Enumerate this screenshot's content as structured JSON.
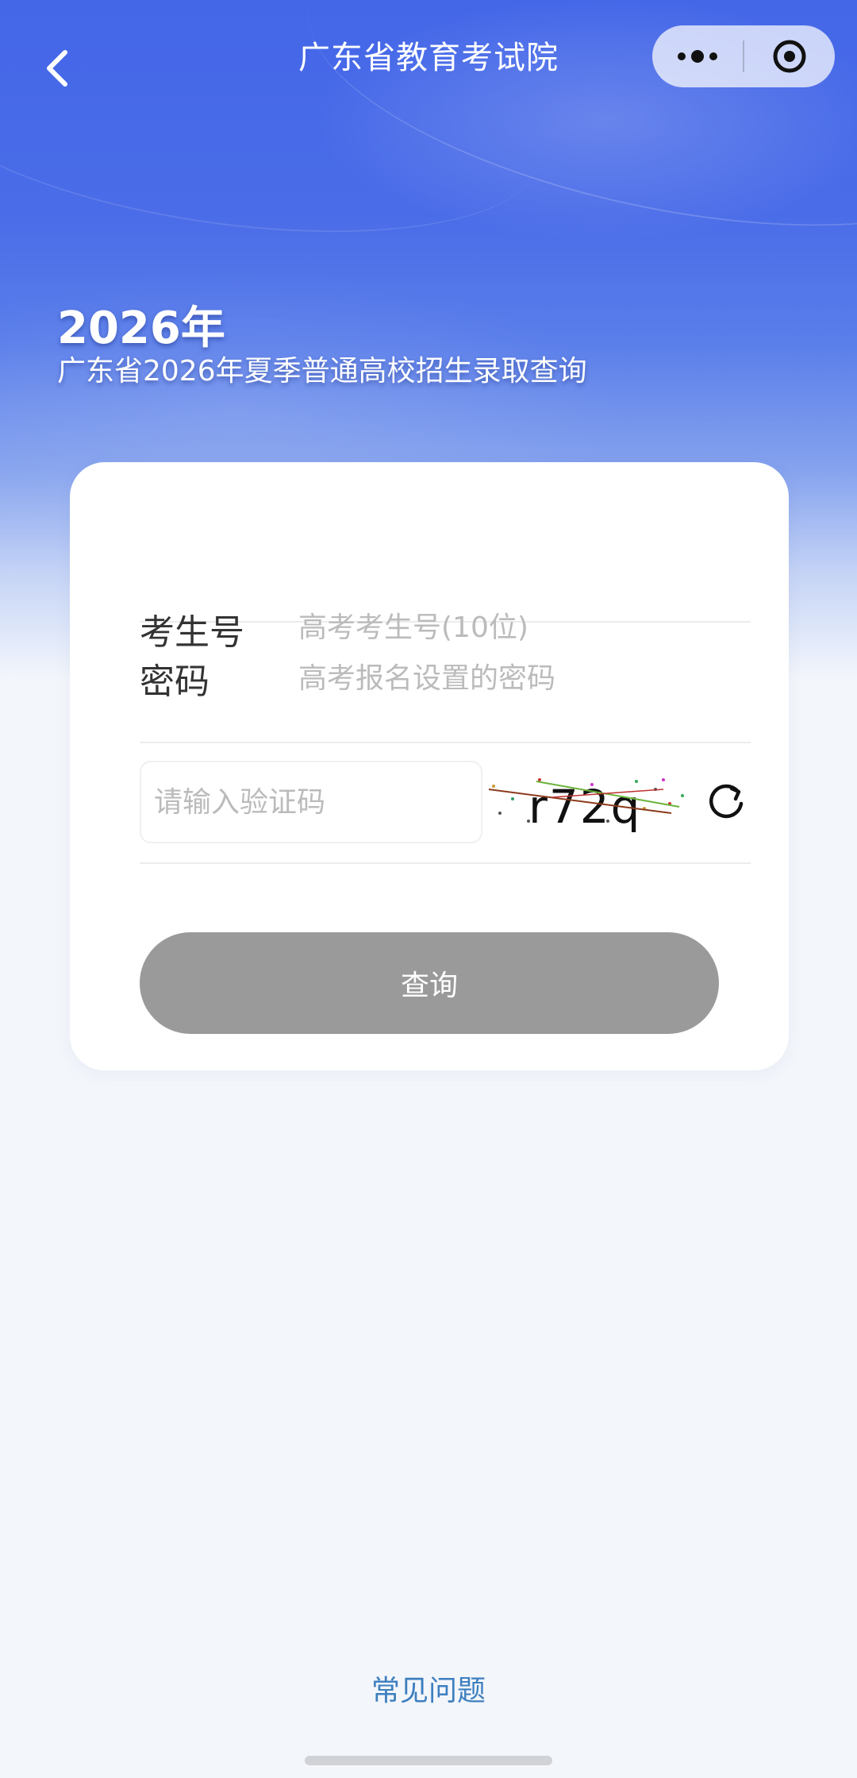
{
  "nav": {
    "title": "广东省教育考试院"
  },
  "hero": {
    "year": "2026年",
    "subtitle": "广东省2026年夏季普通高校招生录取查询"
  },
  "form": {
    "candidate_label": "考生号",
    "candidate_placeholder": "高考考生号(10位)",
    "password_label": "密码",
    "password_placeholder": "高考报名设置的密码",
    "captcha_placeholder": "请输入验证码",
    "captcha_text": "r72q",
    "submit_label": "查询"
  },
  "footer": {
    "faq_label": "常见问题"
  },
  "colors": {
    "brand_blue": "#4467e8",
    "button_disabled": "#9a9a9a",
    "link": "#3d7fbf"
  },
  "icons": {
    "back": "chevron-left-icon",
    "more": "more-dots-icon",
    "close": "target-circle-icon",
    "refresh": "refresh-icon"
  }
}
